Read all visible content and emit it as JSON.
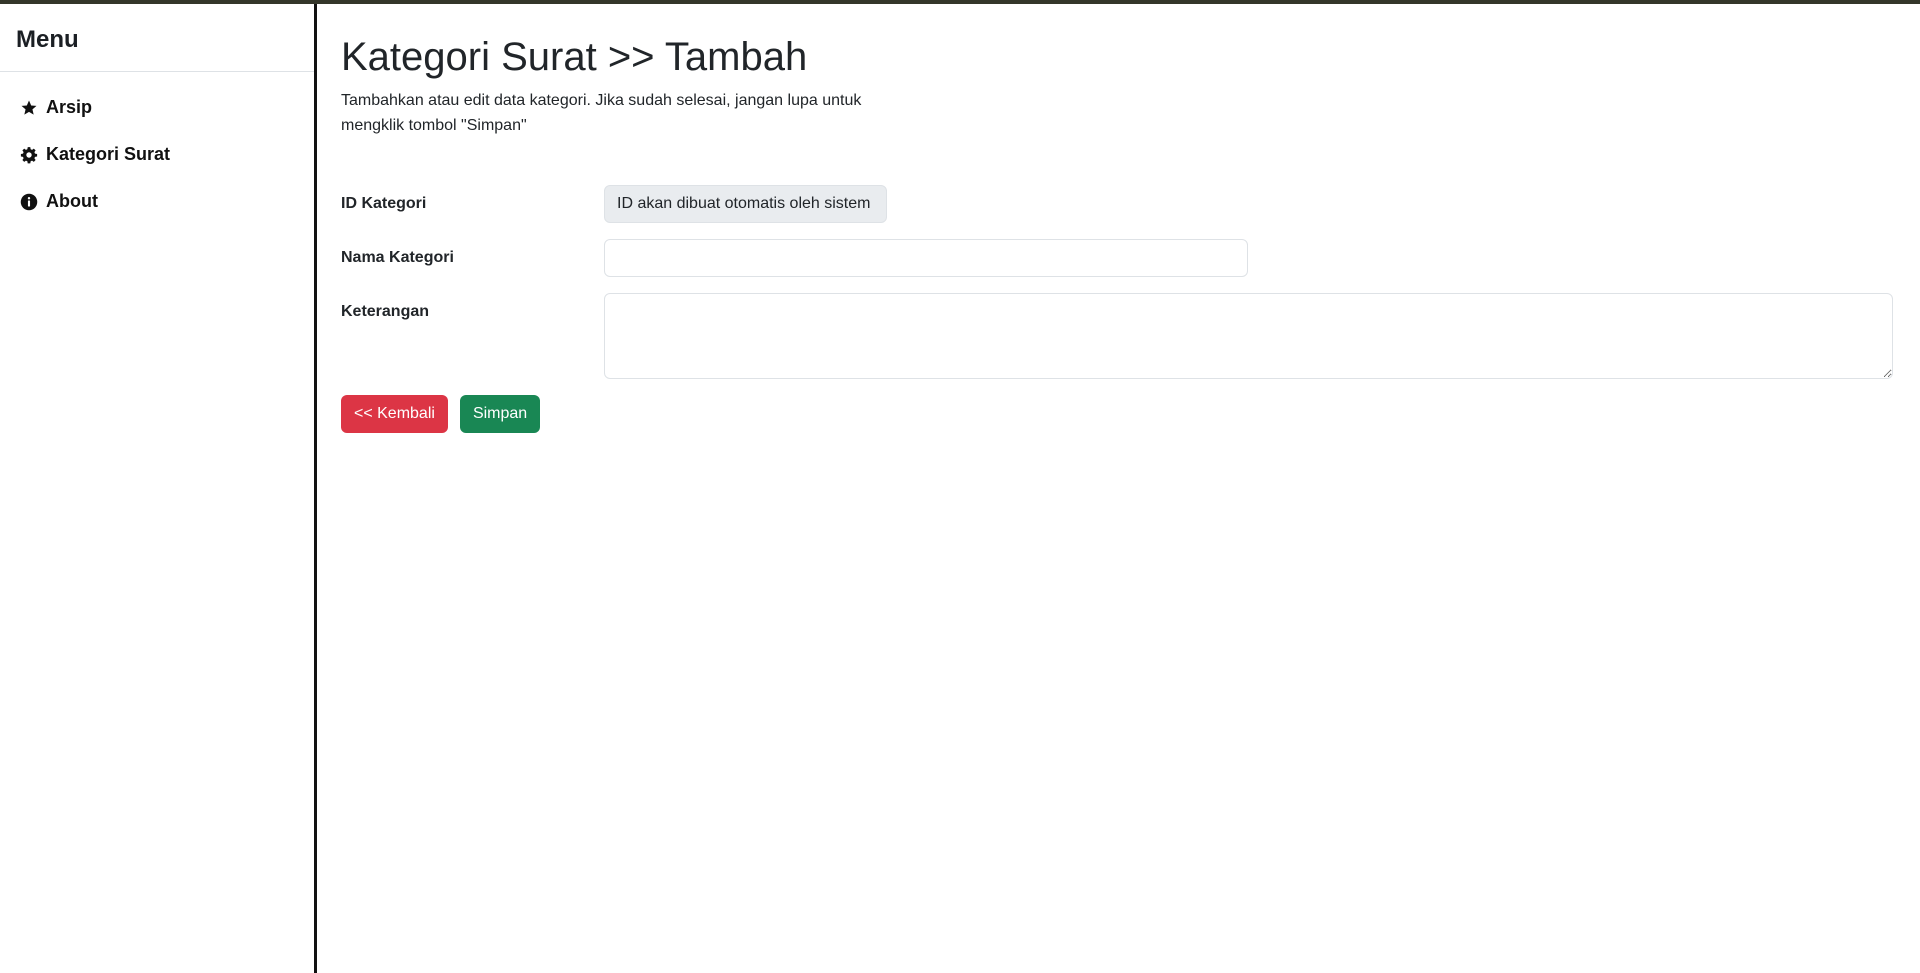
{
  "sidebar": {
    "title": "Menu",
    "items": [
      {
        "label": "Arsip",
        "icon": "star-icon"
      },
      {
        "label": "Kategori Surat",
        "icon": "gear-icon"
      },
      {
        "label": "About",
        "icon": "info-icon"
      }
    ]
  },
  "main": {
    "title": "Kategori Surat >> Tambah",
    "description": "Tambahkan atau edit data kategori. Jika sudah selesai, jangan lupa untuk mengklik tombol \"Simpan\""
  },
  "form": {
    "id_label": "ID Kategori",
    "id_value": "ID akan dibuat otomatis oleh sistem",
    "name_label": "Nama Kategori",
    "name_value": "",
    "desc_label": "Keterangan",
    "desc_value": ""
  },
  "buttons": {
    "back_label": "<< Kembali",
    "save_label": "Simpan"
  },
  "colors": {
    "danger": "#dc3545",
    "success": "#198754",
    "top_border": "#34362a"
  }
}
